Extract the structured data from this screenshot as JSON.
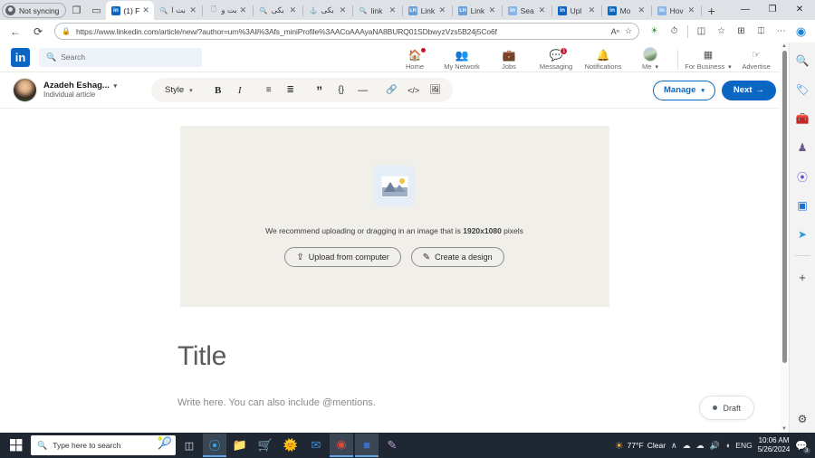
{
  "browser": {
    "profile": {
      "label": "Not syncing",
      "icon": "person-icon"
    },
    "chrome_buttons": [
      {
        "name": "collections-icon",
        "glyph": "❐"
      },
      {
        "name": "split-screen-icon",
        "glyph": "▭"
      }
    ],
    "tabs": [
      {
        "label": "(1) F",
        "favicon": "linkedin-icon",
        "active": true
      },
      {
        "label": "بت ا",
        "favicon": "search-icon",
        "active": false
      },
      {
        "label": "بت و",
        "favicon": "document-icon",
        "active": false
      },
      {
        "label": "بکی",
        "favicon": "search-icon",
        "active": false
      },
      {
        "label": "بکی",
        "favicon": "pin-icon",
        "active": false
      },
      {
        "label": "link",
        "favicon": "search-icon",
        "active": false
      },
      {
        "label": "Link",
        "favicon": "lh-icon",
        "active": false
      },
      {
        "label": "Link",
        "favicon": "lh-icon",
        "active": false
      },
      {
        "label": "Sea",
        "favicon": "linkedin-pale-icon",
        "active": false
      },
      {
        "label": "Upl",
        "favicon": "linkedin-icon",
        "active": false
      },
      {
        "label": "Mo",
        "favicon": "linkedin-icon",
        "active": false
      },
      {
        "label": "Hov",
        "favicon": "linkedin-pale-icon",
        "active": false
      }
    ],
    "new_tab_label": "+",
    "window_controls": {
      "minimize": "—",
      "maximize": "❐",
      "close": "✕"
    },
    "nav": {
      "back": "←",
      "reload": "⟳"
    },
    "address": {
      "lock_icon": "lock-icon",
      "url": "https://www.linkedin.com/article/new/?author=urn%3Ali%3Afs_miniProfile%3AACoAAAyaNA8BURQ01SDbwyzVzs5B24j5Co6f",
      "read_aloud": "Aⁿ",
      "favorite": "☆"
    },
    "toolbar_icons": [
      {
        "name": "browser-essentials-icon",
        "glyph": "◑"
      },
      {
        "name": "history-icon",
        "glyph": "◴"
      },
      {
        "name": "split-screen-icon",
        "glyph": "◫"
      },
      {
        "name": "favorites-icon",
        "glyph": "☆"
      },
      {
        "name": "collections-icon",
        "glyph": "⊞"
      },
      {
        "name": "extensions-icon",
        "glyph": "⌘"
      },
      {
        "name": "settings-more-icon",
        "glyph": "⋯"
      },
      {
        "name": "copilot-icon",
        "glyph": "◕"
      }
    ]
  },
  "linkedin": {
    "logo": "in",
    "search": {
      "placeholder": "Search",
      "icon": "search-icon"
    },
    "nav_items": [
      {
        "label": "Home",
        "icon": "home-icon",
        "glyph": "⌂",
        "badge": ""
      },
      {
        "label": "My Network",
        "icon": "network-icon",
        "glyph": "■■",
        "badge": ""
      },
      {
        "label": "Jobs",
        "icon": "briefcase-icon",
        "glyph": "▬",
        "badge": ""
      },
      {
        "label": "Messaging",
        "icon": "message-icon",
        "glyph": "●",
        "badge": "1"
      },
      {
        "label": "Notifications",
        "icon": "bell-icon",
        "glyph": "▲",
        "badge": ""
      },
      {
        "label": "Me",
        "icon": "avatar-icon",
        "glyph": "",
        "badge": ""
      },
      {
        "label": "For Business",
        "icon": "grid-icon",
        "glyph": "∷",
        "badge": ""
      },
      {
        "label": "Advertise",
        "icon": "advertise-icon",
        "glyph": "➤",
        "badge": ""
      }
    ]
  },
  "editor": {
    "author": {
      "name": "Azadeh Eshag...",
      "subtitle": "Individual article",
      "avatar": "author-avatar"
    },
    "style_button": {
      "label": "Style",
      "caret": "▾"
    },
    "format_buttons": [
      {
        "name": "bold-icon",
        "glyph": "B",
        "title": "Bold"
      },
      {
        "name": "italic-icon",
        "glyph": "I",
        "title": "Italic"
      },
      {
        "name": "bulleted-list-icon",
        "glyph": "☰",
        "title": "Bulleted list"
      },
      {
        "name": "numbered-list-icon",
        "glyph": "☷",
        "title": "Numbered list"
      },
      {
        "name": "quote-icon",
        "glyph": "”",
        "title": "Quote"
      },
      {
        "name": "code-block-icon",
        "glyph": "{}",
        "title": "Code block"
      },
      {
        "name": "divider-icon",
        "glyph": "—",
        "title": "Divider"
      },
      {
        "name": "link-icon",
        "glyph": "ὑ7",
        "title": "Link"
      },
      {
        "name": "inline-code-icon",
        "glyph": "</>",
        "title": "Code"
      },
      {
        "name": "image-icon",
        "glyph": "ὛC",
        "title": "Image"
      }
    ],
    "manage_button": {
      "label": "Manage",
      "caret": "▾"
    },
    "next_button": {
      "label": "Next",
      "arrow": "→"
    },
    "cover": {
      "placeholder_icon": "image-placeholder-icon",
      "hint_prefix": "We recommend uploading or dragging in an image that is ",
      "hint_dimensions": "1920x1080",
      "hint_suffix": " pixels",
      "upload_button": {
        "label": "Upload from computer",
        "icon": "upload-icon",
        "glyph": "⇧"
      },
      "design_button": {
        "label": "Create a design",
        "icon": "design-icon",
        "glyph": "✎"
      }
    },
    "title_placeholder": "Title",
    "body_placeholder": "Write here. You can also include @mentions.",
    "draft_chip": {
      "label": "Draft",
      "dot_color": "#5a6572"
    }
  },
  "edge_sidebar": {
    "icons": [
      {
        "name": "search-icon",
        "glyph": "🔍"
      },
      {
        "name": "shopping-tag-icon",
        "glyph": "🏷"
      },
      {
        "name": "tools-icon",
        "glyph": "🧰"
      },
      {
        "name": "games-icon",
        "glyph": "♟"
      },
      {
        "name": "microsoft-365-icon",
        "glyph": "◔"
      },
      {
        "name": "outlook-icon",
        "glyph": "▣"
      },
      {
        "name": "telegram-icon",
        "glyph": "➤"
      }
    ],
    "add_button": "+",
    "settings_icon": "gear-icon"
  },
  "taskbar": {
    "start": "start-icon",
    "search": {
      "placeholder": "Type here to search",
      "icon": "search-icon"
    },
    "task_view": "task-view-icon",
    "apps": [
      {
        "name": "edge-icon",
        "active": true
      },
      {
        "name": "file-explorer-icon",
        "active": false
      },
      {
        "name": "microsoft-store-icon",
        "active": false
      },
      {
        "name": "firefox-icon",
        "active": false
      },
      {
        "name": "mail-icon",
        "active": false
      },
      {
        "name": "chrome-icon",
        "active": true
      },
      {
        "name": "word-icon",
        "active": true
      },
      {
        "name": "paint-3d-icon",
        "active": false
      }
    ],
    "tray": {
      "weather_temp": "77°F",
      "weather_desc": "Clear",
      "chevron": "∧",
      "icons": [
        {
          "name": "onedrive-icon",
          "glyph": "☁"
        },
        {
          "name": "network-icon",
          "glyph": "◢"
        },
        {
          "name": "volume-icon",
          "glyph": "♪"
        }
      ],
      "language": "ENG",
      "time": "10:06 AM",
      "date": "5/26/2024",
      "notifications_count": "3"
    }
  },
  "colors": {
    "linkedin_blue": "#0a66c2",
    "badge_red": "#cb112d",
    "page_bg": "#f4f2ee",
    "cover_bg": "#f1efea",
    "taskbar_bg": "#1f2733"
  }
}
